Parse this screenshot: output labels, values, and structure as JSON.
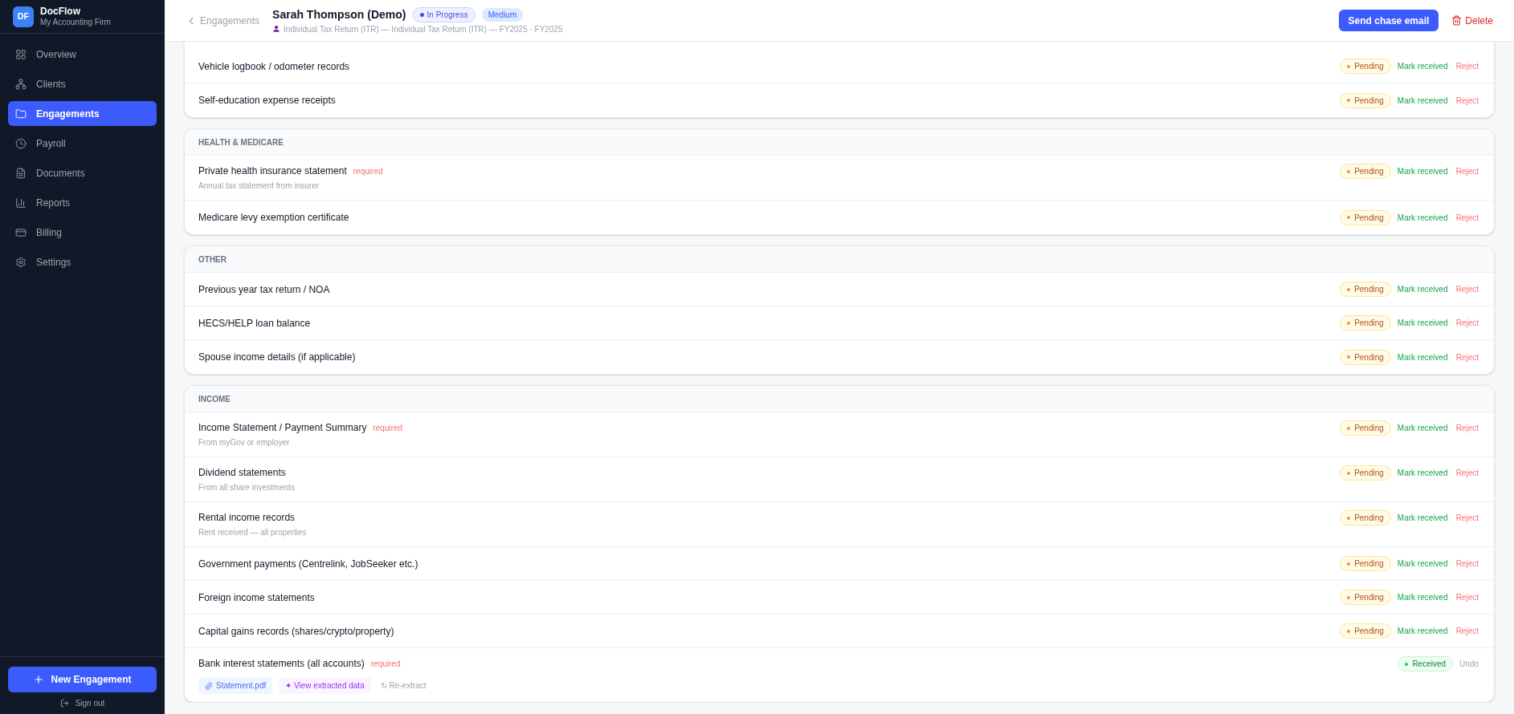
{
  "brand": {
    "logo": "DF",
    "name": "DocFlow",
    "firm": "My Accounting Firm"
  },
  "sidebar": {
    "items": [
      {
        "label": "Overview",
        "selected": false
      },
      {
        "label": "Clients",
        "selected": false
      },
      {
        "label": "Engagements",
        "selected": true
      },
      {
        "label": "Payroll",
        "selected": false
      },
      {
        "label": "Documents",
        "selected": false
      },
      {
        "label": "Reports",
        "selected": false
      },
      {
        "label": "Billing",
        "selected": false
      },
      {
        "label": "Settings",
        "selected": false
      }
    ],
    "new_button": "New Engagement",
    "sign_out": "Sign out"
  },
  "header": {
    "back": "Engagements",
    "title": "Sarah Thompson (Demo)",
    "status": "In Progress",
    "priority": "Medium",
    "subtitle": "Individual Tax Return (ITR) — Individual Tax Return (ITR) — FY2025 · FY2025",
    "chase_button": "Send chase email",
    "delete_button": "Delete"
  },
  "sections": [
    {
      "items": [
        {
          "name": "Vehicle logbook / odometer records",
          "kind": "pending",
          "status_label": "Pending",
          "actions": [
            "Mark received",
            "Reject"
          ]
        },
        {
          "name": "Self-education expense receipts",
          "kind": "pending",
          "status_label": "Pending",
          "actions": [
            "Mark received",
            "Reject"
          ]
        }
      ]
    },
    {
      "title": "HEALTH & MEDICARE",
      "items": [
        {
          "name": "Private health insurance statement",
          "required": "required",
          "note": "Annual tax statement from insurer",
          "kind": "pending",
          "status_label": "Pending",
          "actions": [
            "Mark received",
            "Reject"
          ]
        },
        {
          "name": "Medicare levy exemption certificate",
          "kind": "pending",
          "status_label": "Pending",
          "actions": [
            "Mark received",
            "Reject"
          ]
        }
      ]
    },
    {
      "title": "OTHER",
      "items": [
        {
          "name": "Previous year tax return / NOA",
          "kind": "pending",
          "status_label": "Pending",
          "actions": [
            "Mark received",
            "Reject"
          ]
        },
        {
          "name": "HECS/HELP loan balance",
          "kind": "pending",
          "status_label": "Pending",
          "actions": [
            "Mark received",
            "Reject"
          ]
        },
        {
          "name": "Spouse income details (if applicable)",
          "kind": "pending",
          "status_label": "Pending",
          "actions": [
            "Mark received",
            "Reject"
          ]
        }
      ]
    },
    {
      "title": "INCOME",
      "items": [
        {
          "name": "Income Statement / Payment Summary",
          "required": "required",
          "note": "From myGov or employer",
          "kind": "pending",
          "status_label": "Pending",
          "actions": [
            "Mark received",
            "Reject"
          ]
        },
        {
          "name": "Dividend statements",
          "note": "From all share investments",
          "kind": "pending",
          "status_label": "Pending",
          "actions": [
            "Mark received",
            "Reject"
          ]
        },
        {
          "name": "Rental income records",
          "note": "Rent received — all properties",
          "kind": "pending",
          "status_label": "Pending",
          "actions": [
            "Mark received",
            "Reject"
          ]
        },
        {
          "name": "Government payments (Centrelink, JobSeeker etc.)",
          "kind": "pending",
          "status_label": "Pending",
          "actions": [
            "Mark received",
            "Reject"
          ]
        },
        {
          "name": "Foreign income statements",
          "kind": "pending",
          "status_label": "Pending",
          "actions": [
            "Mark received",
            "Reject"
          ]
        },
        {
          "name": "Capital gains records (shares/crypto/property)",
          "kind": "pending",
          "status_label": "Pending",
          "actions": [
            "Mark received",
            "Reject"
          ]
        },
        {
          "name": "Bank interest statements (all accounts)",
          "required": "required",
          "kind": "received",
          "status_label": "Received",
          "actions": [
            "Undo"
          ],
          "file": "Statement.pdf",
          "extract": "✦ View extracted data",
          "reextract": "↻ Re-extract"
        }
      ]
    }
  ]
}
